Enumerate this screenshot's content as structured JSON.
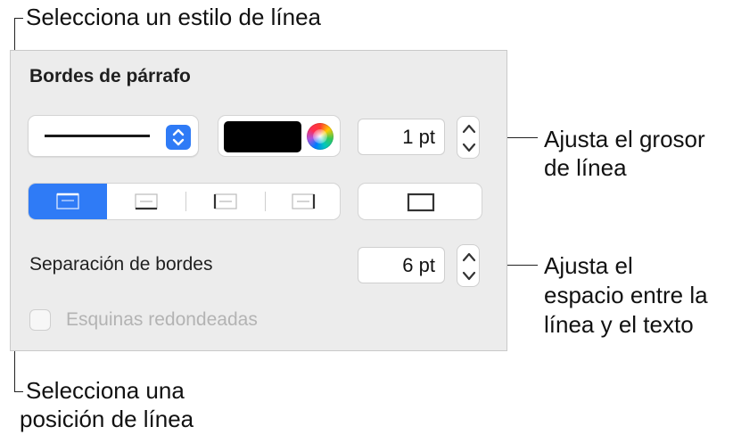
{
  "callouts": {
    "line_style": "Selecciona un estilo de línea",
    "thickness_line1": "Ajusta el grosor",
    "thickness_line2": "de línea",
    "spacing_line1": "Ajusta el",
    "spacing_line2": "espacio entre la",
    "spacing_line3": "línea y el texto",
    "position_line1": "Selecciona una",
    "position_line2": "posición de línea"
  },
  "panel": {
    "title": "Bordes de párrafo",
    "line_style_popup": {
      "icon": "chevron-up-down-icon",
      "accent": "#2f7bf6"
    },
    "color_well": {
      "color": "#000000",
      "icon": "color-wheel-icon"
    },
    "thickness": {
      "value": "1 pt"
    },
    "position_options": [
      {
        "name": "top-border-icon",
        "selected": true
      },
      {
        "name": "bottom-border-icon",
        "selected": false
      },
      {
        "name": "left-border-icon",
        "selected": false
      },
      {
        "name": "right-border-icon",
        "selected": false
      }
    ],
    "box_border_icon": "box-border-icon",
    "spacing_label": "Separación de bordes",
    "spacing_value": "6 pt",
    "rounded_corners_label": "Esquinas redondeadas"
  }
}
